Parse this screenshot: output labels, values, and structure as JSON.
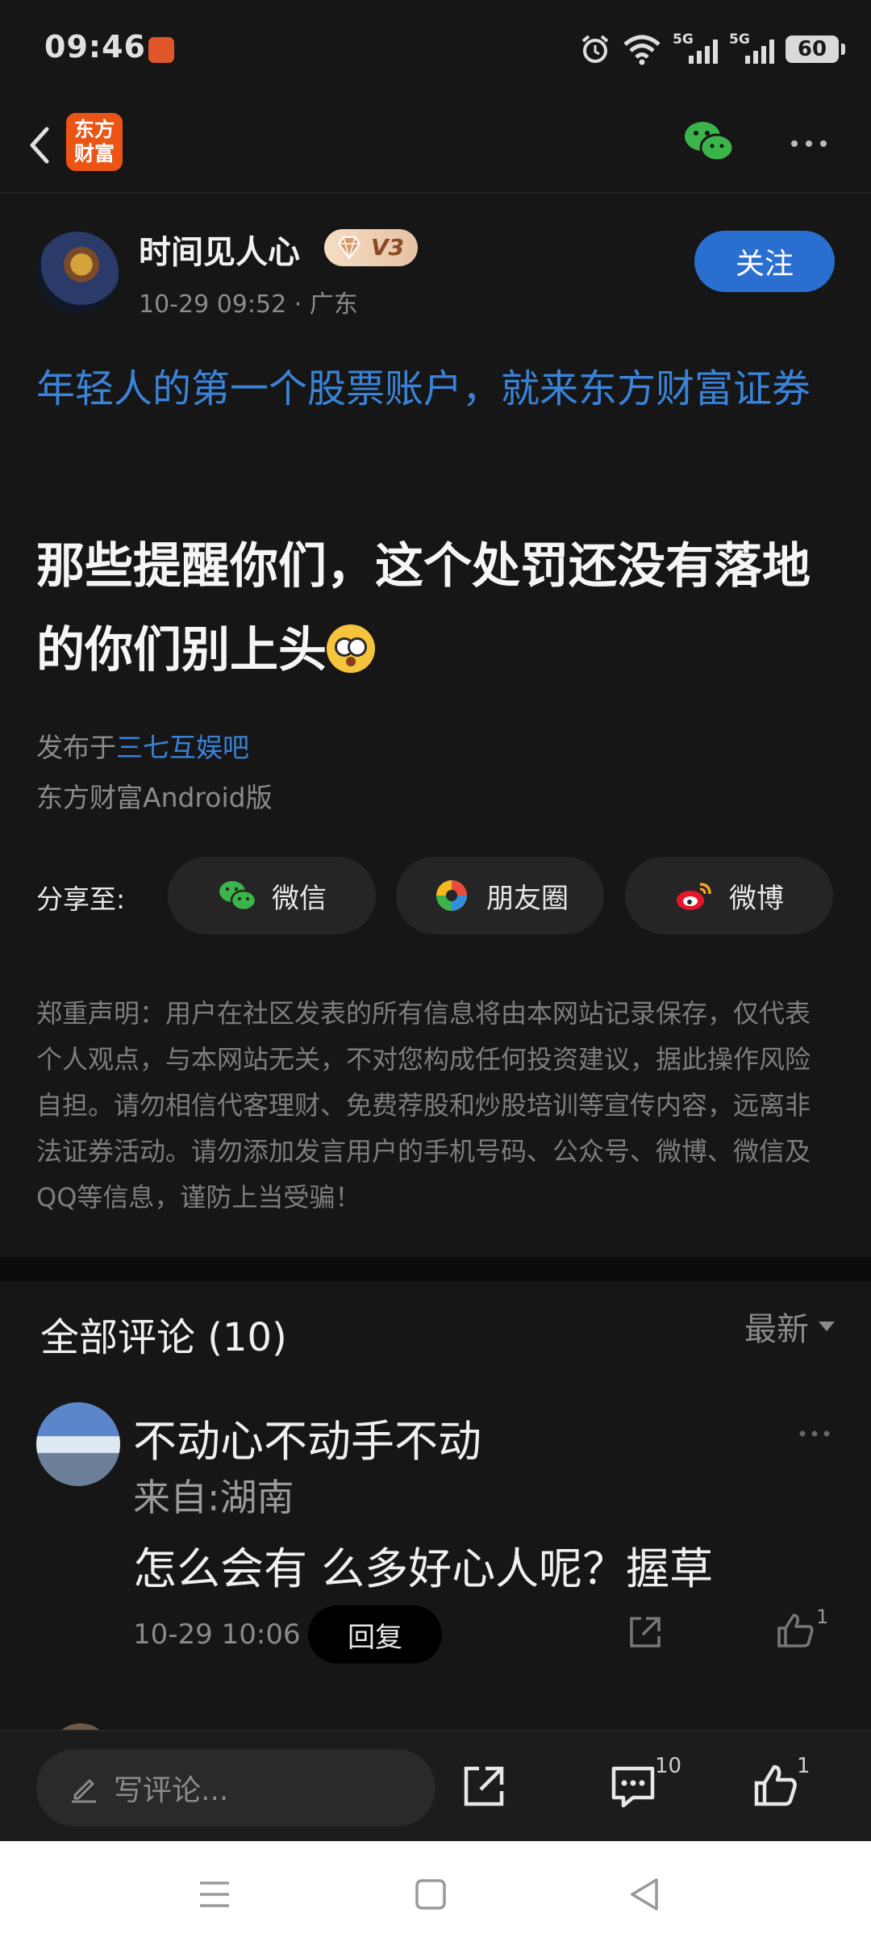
{
  "status_bar": {
    "time": "09:46",
    "signal1_label": "5G",
    "signal2_label": "5G",
    "battery": "60"
  },
  "nav": {
    "logo_line1": "东方",
    "logo_line2": "财富"
  },
  "author": {
    "name": "时间见人心",
    "level": "V3",
    "meta": "10-29 09:52 · 广东",
    "follow_label": "关注"
  },
  "post": {
    "link_text": "年轻人的第一个股票账户，就来东方财富证券",
    "title": "那些提醒你们，这个处罚还没有落地的你们别上头",
    "source_prefix": "发布于",
    "source_forum": "三七互娱吧",
    "client": "东方财富Android版"
  },
  "share": {
    "label": "分享至:",
    "wechat": "微信",
    "moments": "朋友圈",
    "weibo": "微博"
  },
  "disclaimer": "郑重声明：用户在社区发表的所有信息将由本网站记录保存，仅代表个人观点，与本网站无关，不对您构成任何投资建议，据此操作风险自担。请勿相信代客理财、免费荐股和炒股培训等宣传内容，远离非法证券活动。请勿添加发言用户的手机号码、公众号、微博、微信及QQ等信息，谨防上当受骗！",
  "comments": {
    "title": "全部评论",
    "count": "(10)",
    "sort": "最新",
    "items": [
      {
        "user": "不动心不动手不动",
        "location": "来自:湖南",
        "text": "怎么会有 么多好心人呢？握草",
        "time": "10-29 10:06",
        "reply_label": "回复",
        "likes": "1"
      }
    ]
  },
  "bottom_bar": {
    "placeholder": "写评论...",
    "comment_count": "10",
    "like_count": "1"
  },
  "colors": {
    "background": "#161616",
    "accent_blue": "#2a6fcf",
    "link_blue": "#3a83d8",
    "brand_orange": "#ea5414",
    "wechat_green": "#3bb44a"
  }
}
